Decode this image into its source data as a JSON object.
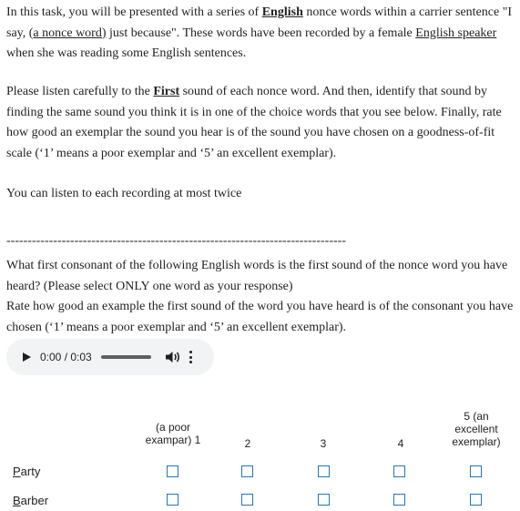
{
  "intro": {
    "s1": "In this task, you will be presented with a series of ",
    "english1": "English",
    "s2": " nonce words within a carrier sentence \"I say, (",
    "nonce": "a nonce word)",
    "s3": " just because\". These words have been recorded by a female ",
    "speaker": "English speaker",
    "s4": " when she was reading some English sentences."
  },
  "instructions": {
    "s1": "Please listen carefully to the ",
    "first": "First",
    "s2": " sound of each nonce word. And then, identify that sound by finding the same sound you think it is in one of the choice words that you see below. Finally, rate how good an exemplar the sound you hear is of the sound you have chosen on a goodness-of-fit scale (‘1’ means a poor exemplar and ‘5’ an excellent exemplar)."
  },
  "listen_note": "You can listen to each recording at most twice",
  "divider": "--------------------------------------------------------------------------------",
  "question": {
    "line1": "What first consonant of the following English words is the first sound of the nonce word you have heard? (Please select ONLY one word as your response)",
    "line2": "Rate how good an example the first sound of the word you have heard is of the consonant you have chosen (‘1’ means a poor exemplar and ‘5’ an excellent exemplar)."
  },
  "audio": {
    "time": "0:00 / 0:03",
    "progress": 0
  },
  "scale": {
    "h1": "(a poor exampar) 1",
    "h2": "2",
    "h3": "3",
    "h4": "4",
    "h5": "5 (an excellent exemplar)"
  },
  "rows": [
    {
      "first": "P",
      "rest": "arty"
    },
    {
      "first": "B",
      "rest": "arber"
    }
  ],
  "colors": {
    "checkbox": "#1f77c4",
    "player_bg": "#f1f3f4"
  },
  "icons": [
    "play-icon",
    "volume-icon",
    "more-options-icon",
    "checkbox-icon"
  ]
}
